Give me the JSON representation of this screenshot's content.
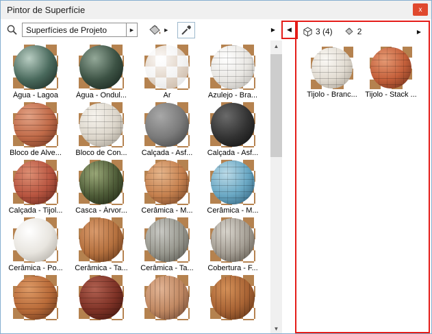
{
  "annotations": {
    "color": "#e41b17"
  },
  "icons": {
    "close": "x",
    "arrow_right": "▶",
    "arrow_left": "◀",
    "arrow_up": "▲",
    "arrow_down": "▼"
  },
  "window": {
    "title": "Pintor de Superfície"
  },
  "toolbar": {
    "search_value": "Superfícies de Projeto"
  },
  "right_panel": {
    "surface_count": "3 (4)",
    "paint_count": "2",
    "items": [
      {
        "label": "Tijolo - Branc...",
        "colors": [
          "#fbf9f5",
          "#e2dcd2",
          "#a79f93"
        ],
        "pattern": "grid"
      },
      {
        "label": "Tijolo - Stack ...",
        "colors": [
          "#e59a74",
          "#c45f3a",
          "#6b2f1a"
        ],
        "pattern": "grid"
      }
    ]
  },
  "materials": [
    {
      "label": "Água - Lagoa",
      "colors": [
        "#b8cdc2",
        "#49695c",
        "#17251f"
      ],
      "pattern": "none"
    },
    {
      "label": "Água - Ondul...",
      "colors": [
        "#93a898",
        "#3c5244",
        "#131f18"
      ],
      "pattern": "none"
    },
    {
      "label": "Ar",
      "colors": [
        "rgba(255,255,255,0.95)",
        "rgba(240,240,240,0.75)",
        "rgba(205,205,205,0.65)"
      ],
      "pattern": "none"
    },
    {
      "label": "Azulejo - Bra...",
      "colors": [
        "#ffffff",
        "#e9e7e3",
        "#b3b0ab"
      ],
      "pattern": "grid"
    },
    {
      "label": "Bloco de Alve...",
      "colors": [
        "#e2a184",
        "#c06a48",
        "#66301c"
      ],
      "pattern": "h"
    },
    {
      "label": "Bloco de Con...",
      "colors": [
        "#f7f4ee",
        "#dcd6cb",
        "#9e978b"
      ],
      "pattern": "grid"
    },
    {
      "label": "Calçada - Asf...",
      "colors": [
        "#a8a8a8",
        "#7a7a7a",
        "#3e3e3e"
      ],
      "pattern": "none"
    },
    {
      "label": "Calçada - Asf...",
      "colors": [
        "#6a6a6a",
        "#333333",
        "#0e0e0e"
      ],
      "pattern": "none"
    },
    {
      "label": "Calçada - Tijol...",
      "colors": [
        "#dd8f74",
        "#b85540",
        "#5f241a"
      ],
      "pattern": "grid"
    },
    {
      "label": "Casca - Árvor...",
      "colors": [
        "#9aa878",
        "#4e5c38",
        "#1d2412"
      ],
      "pattern": "v"
    },
    {
      "label": "Cerâmica - M...",
      "colors": [
        "#e6b68c",
        "#c5804e",
        "#6d3f22"
      ],
      "pattern": "grid"
    },
    {
      "label": "Cerâmica - M...",
      "colors": [
        "#bcdbe8",
        "#6aa8c4",
        "#2c5a74"
      ],
      "pattern": "grid"
    },
    {
      "label": "Cerâmica - Po...",
      "colors": [
        "#ffffff",
        "#e8e5df",
        "#aaa59d"
      ],
      "pattern": "none"
    },
    {
      "label": "Cerâmica - Ta...",
      "colors": [
        "#d99a6c",
        "#b4703e",
        "#5f3418"
      ],
      "pattern": "v"
    },
    {
      "label": "Cerâmica - Ta...",
      "colors": [
        "#c9c9c4",
        "#98988f",
        "#55554e"
      ],
      "pattern": "v"
    },
    {
      "label": "Cobertura - F...",
      "colors": [
        "#d8d4cc",
        "#a49e94",
        "#5a544a"
      ],
      "pattern": "v"
    },
    {
      "label": "",
      "colors": [
        "#dd9a66",
        "#b86a38",
        "#5f321a"
      ],
      "pattern": "h"
    },
    {
      "label": "",
      "colors": [
        "#b06050",
        "#7e3226",
        "#3a120c"
      ],
      "pattern": "h"
    },
    {
      "label": "",
      "colors": [
        "#e2b494",
        "#c08862",
        "#6a4430"
      ],
      "pattern": "v"
    },
    {
      "label": "",
      "colors": [
        "#d49058",
        "#a86334",
        "#5a2f14"
      ],
      "pattern": "v"
    }
  ]
}
